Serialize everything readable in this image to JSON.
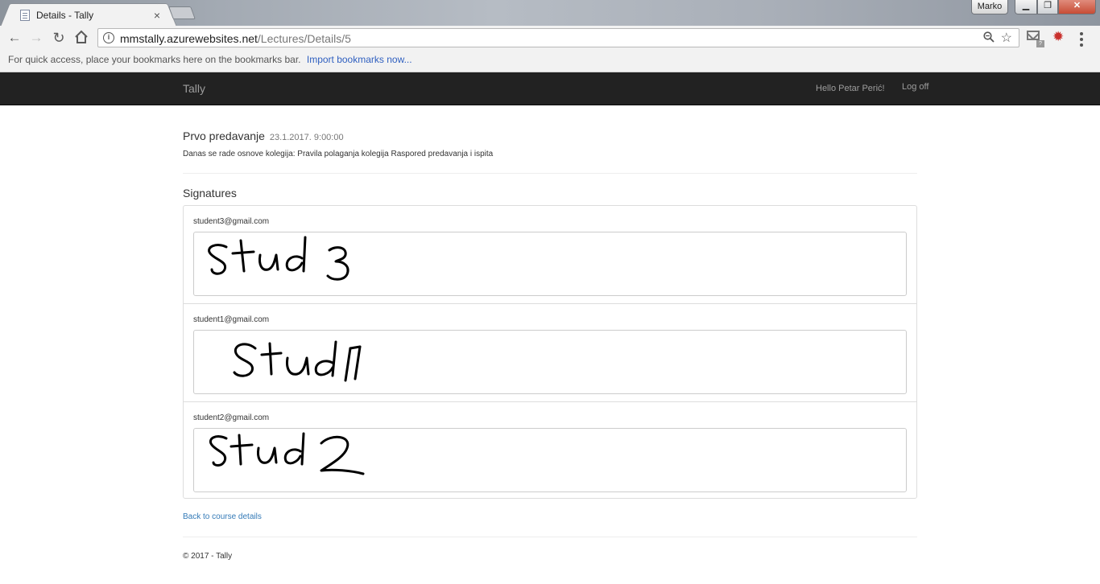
{
  "browser": {
    "tab_title": "Details - Tally",
    "tab_close": "×",
    "profile_name": "Marko",
    "window_controls": {
      "minimize": "▁",
      "maximize": "❐",
      "close": "✕"
    },
    "url_host": "mmstally.azurewebsites.net",
    "url_path": "/Lectures/Details/5",
    "icons": [
      "back-arrow-icon",
      "forward-arrow-icon",
      "reload-icon",
      "home-icon",
      "info-icon",
      "zoom-icon",
      "star-icon",
      "gmail-icon",
      "extension-gear-icon",
      "menu-icon"
    ],
    "bookmarks_hint": "For quick access, place your bookmarks here on the bookmarks bar.",
    "bookmarks_import": "Import bookmarks now..."
  },
  "navbar": {
    "brand": "Tally",
    "greeting": "Hello Petar Perić!",
    "logoff": "Log off"
  },
  "lecture": {
    "title": "Prvo predavanje",
    "date": "23.1.2017. 9:00:00",
    "description": "Danas se rade osnove kolegija:  Pravila polaganja kolegija Raspored predavanja i ispita"
  },
  "signatures_heading": "Signatures",
  "signatures": [
    {
      "email": "student3@gmail.com",
      "handwriting": "Stud 3"
    },
    {
      "email": "student1@gmail.com",
      "handwriting": "Stud1"
    },
    {
      "email": "student2@gmail.com",
      "handwriting": "Stud2"
    }
  ],
  "back_link": "Back to course details",
  "footer": "© 2017 - Tally",
  "colors": {
    "navbar_bg": "#222222",
    "navbar_text": "#9d9d9d",
    "link": "#337ab7",
    "close_button": "#c74c35"
  }
}
